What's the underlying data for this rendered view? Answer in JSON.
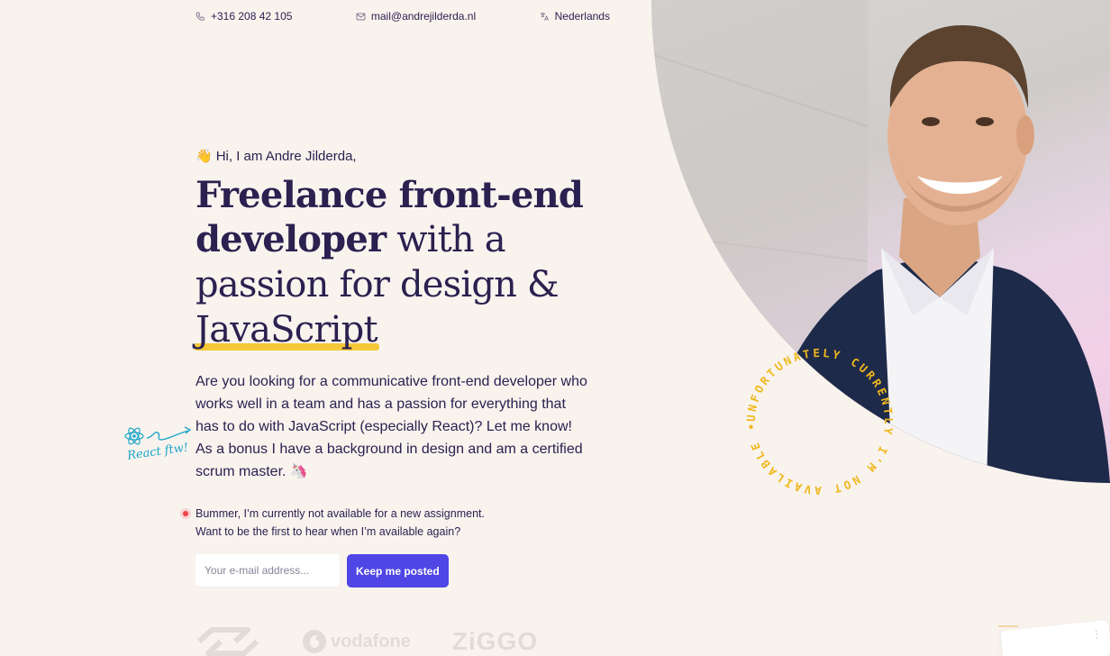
{
  "topbar": {
    "phone": "+316 208 42 105",
    "email": "mail@andrejilderda.nl",
    "language": "Nederlands"
  },
  "hero": {
    "greeting": "Hi, I am Andre Jilderda,",
    "headline_bold": "Freelance front-end developer",
    "headline_light_1": " with a passion for design & ",
    "headline_underlined": "JavaScript",
    "intro": "Are you looking for a communicative front-end developer who works well in a team and has a passion for everything that has to do with JavaScript (especially React)? Let me know! As a bonus I have a background in design and am a certified scrum master. 🦄",
    "annotation": "React ftw!"
  },
  "availability": {
    "line1": "Bummer, I’m currently not available for a new assignment.",
    "line2": "Want to be the first to hear when I’m available again?"
  },
  "form": {
    "placeholder": "Your e-mail address...",
    "button": "Keep me posted"
  },
  "logos": {
    "vodafone": "vodafone",
    "ziggo": "ZiGGO"
  },
  "badge": {
    "text": "UNFORTUNATELY CURRENTLY I'M NOT AVAILABLE •"
  },
  "colors": {
    "background": "#f9f3ee",
    "primary": "#2a2150",
    "accent": "#4f46e5",
    "highlight": "#f4c838",
    "badge": "#f0b81d",
    "status_dot": "#ef3f4a"
  }
}
